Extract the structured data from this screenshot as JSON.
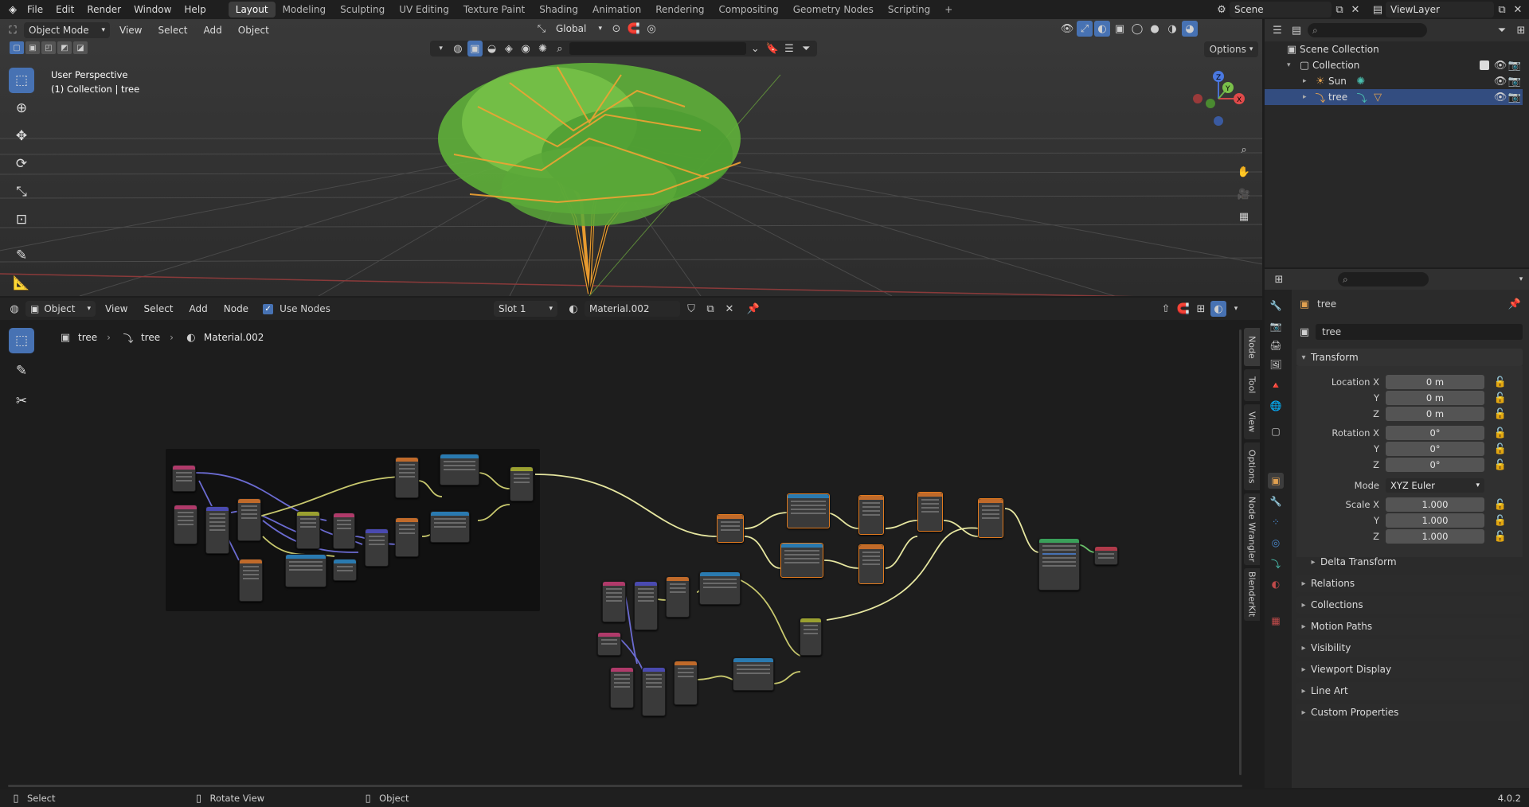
{
  "topbar": {
    "menus": [
      "File",
      "Edit",
      "Render",
      "Window",
      "Help"
    ],
    "workspaces": [
      "Layout",
      "Modeling",
      "Sculpting",
      "UV Editing",
      "Texture Paint",
      "Shading",
      "Animation",
      "Rendering",
      "Compositing",
      "Geometry Nodes",
      "Scripting"
    ],
    "active_workspace": "Layout",
    "add_tab": "+",
    "scene": "Scene",
    "view_layer": "ViewLayer"
  },
  "viewport": {
    "mode": "Object Mode",
    "menus": [
      "View",
      "Select",
      "Add",
      "Object"
    ],
    "orientation": "Global",
    "options_label": "Options",
    "overlay_title": "User Perspective",
    "overlay_subtitle": "(1) Collection | tree",
    "gizmo": {
      "x": "X",
      "y": "Y",
      "z": "Z"
    }
  },
  "node_editor": {
    "object_type": "Object",
    "menus": [
      "View",
      "Select",
      "Add",
      "Node"
    ],
    "use_nodes_label": "Use Nodes",
    "use_nodes_checked": true,
    "slot": "Slot 1",
    "material": "Material.002",
    "breadcrumb": [
      "tree",
      "tree",
      "Material.002"
    ],
    "side_tabs": [
      "Node",
      "Tool",
      "View",
      "Options",
      "Node Wrangler",
      "BlenderKit"
    ]
  },
  "outliner": {
    "search_placeholder": "",
    "items": [
      {
        "label": "Scene Collection",
        "level": 0
      },
      {
        "label": "Collection",
        "level": 1
      },
      {
        "label": "Sun",
        "level": 2
      },
      {
        "label": "tree",
        "level": 2,
        "selected": true
      }
    ]
  },
  "properties": {
    "object_name": "tree",
    "data_name": "tree",
    "transform_label": "Transform",
    "rows": [
      {
        "label": "Location X",
        "value": "0 m"
      },
      {
        "label": "Y",
        "value": "0 m"
      },
      {
        "label": "Z",
        "value": "0 m"
      },
      {
        "label": "Rotation X",
        "value": "0°"
      },
      {
        "label": "Y",
        "value": "0°"
      },
      {
        "label": "Z",
        "value": "0°"
      },
      {
        "label": "Mode",
        "value": "XYZ Euler"
      },
      {
        "label": "Scale X",
        "value": "1.000"
      },
      {
        "label": "Y",
        "value": "1.000"
      },
      {
        "label": "Z",
        "value": "1.000"
      }
    ],
    "delta_transform": "Delta Transform",
    "panels": [
      "Relations",
      "Collections",
      "Motion Paths",
      "Visibility",
      "Viewport Display",
      "Line Art",
      "Custom Properties"
    ]
  },
  "statusbar": {
    "select": "Select",
    "rotate": "Rotate View",
    "object": "Object",
    "version": "4.0.2"
  },
  "colors": {
    "accent": "#4772b3",
    "selected_node": "#e07a1f",
    "wire_yellow": "#c8c86e",
    "wire_purple": "#6b6bd1"
  }
}
